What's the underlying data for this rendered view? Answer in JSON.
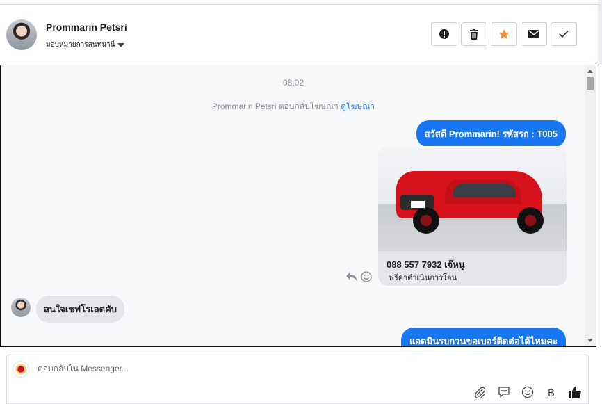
{
  "header": {
    "name": "Prommarin Petsri",
    "assign_label": "มอบหมายการสนทนานี้"
  },
  "chat": {
    "time": "08:02",
    "notice_prefix": "Prommarin Petsri ตอบกลับโฆษณา",
    "notice_link": "ดูโฆษณา",
    "messages": {
      "out_1": "สวัสดี Prommarin! รหัสรถ : T005",
      "card_title": "088 557 7932 เจ๊หนู",
      "card_subtitle": "ฟรีค่าดำเนินการโอน",
      "in_1": "สนใจเชฟโรเลตคับ",
      "out_2": "แอดมินรบกวนขอเบอร์ติดต่อได้ไหมคะ"
    }
  },
  "composer": {
    "placeholder": "ตอบกลับใน Messenger..."
  },
  "icons": {
    "actions": [
      "alert-icon",
      "trash-icon",
      "star-icon",
      "mail-icon",
      "check-icon"
    ],
    "tools": [
      "paperclip-icon",
      "speech-bubble-icon",
      "emoji-icon",
      "baht-icon",
      "thumbs-up-icon"
    ]
  },
  "colors": {
    "accent": "#1877f2",
    "star": "#f7923a",
    "bubble_in": "#e4e6eb"
  }
}
